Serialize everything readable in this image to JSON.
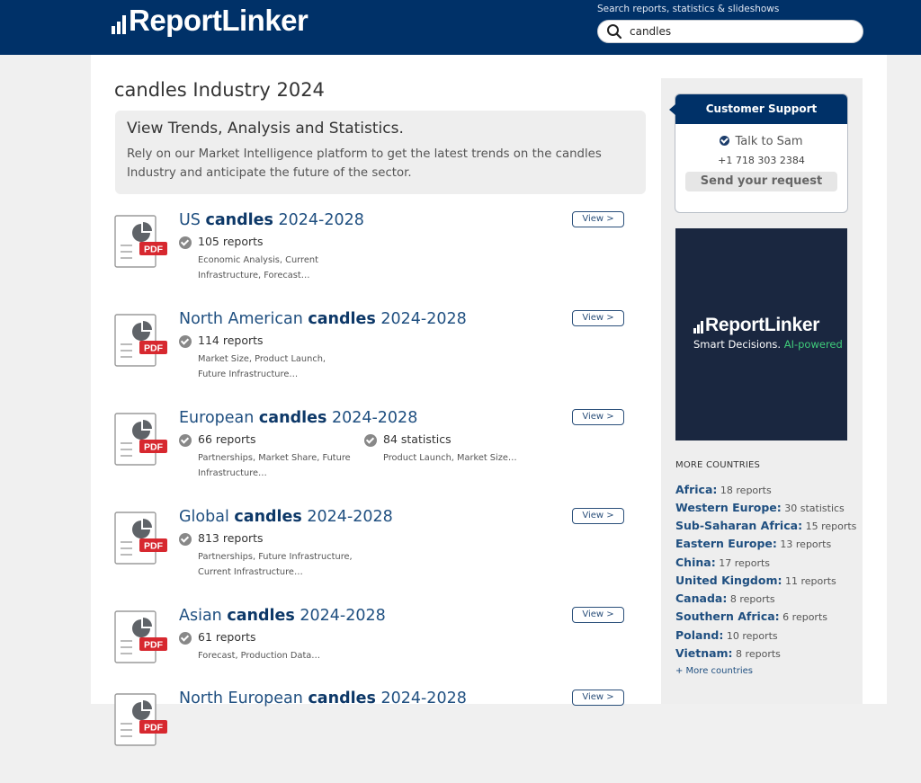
{
  "header": {
    "logo_text": "ReportLinker",
    "search_hint": "Search reports, statistics & slideshows",
    "search_value": "candles"
  },
  "page": {
    "title": "candles Industry 2024",
    "intro_title": "View Trends, Analysis and Statistics.",
    "intro_text": "Rely on our Market Intelligence platform to get the latest trends on the candles Industry and anticipate the future of the sector."
  },
  "results": [
    {
      "prefix": "US ",
      "keyword": "candles",
      "suffix": " 2024-2028",
      "view_label": "View >",
      "reports_count": "105 reports",
      "reports_desc": "Economic Analysis, Current Infrastructure, Forecast…"
    },
    {
      "prefix": "North American ",
      "keyword": "candles",
      "suffix": " 2024-2028",
      "view_label": "View >",
      "reports_count": "114 reports",
      "reports_desc": "Market Size, Product Launch, Future Infrastructure…"
    },
    {
      "prefix": "European ",
      "keyword": "candles",
      "suffix": " 2024-2028",
      "view_label": "View >",
      "reports_count": "66 reports",
      "reports_desc": "Partnerships, Market Share, Future Infrastructure…",
      "stats_count": "84 statistics",
      "stats_desc": "Product Launch, Market Size…"
    },
    {
      "prefix": "Global ",
      "keyword": "candles",
      "suffix": " 2024-2028",
      "view_label": "View >",
      "reports_count": "813 reports",
      "reports_desc": "Partnerships, Future Infrastructure, Current Infrastructure…"
    },
    {
      "prefix": "Asian ",
      "keyword": "candles",
      "suffix": " 2024-2028",
      "view_label": "View >",
      "reports_count": "61 reports",
      "reports_desc": "Forecast, Production Data…"
    },
    {
      "prefix": "North European ",
      "keyword": "candles",
      "suffix": " 2024-2028",
      "view_label": "View >"
    }
  ],
  "icons": {
    "pdf_label": "PDF"
  },
  "support": {
    "title": "Customer Support",
    "contact": "Talk to Sam",
    "phone": "+1 718 303 2384",
    "button": "Send your request"
  },
  "ad": {
    "logo_text": "ReportLinker",
    "tagline_main": "Smart Decisions. ",
    "tagline_ai": "AI-powered"
  },
  "more_countries": {
    "heading": "MORE COUNTRIES",
    "items": [
      {
        "name": "Africa:",
        "count": " 18 reports"
      },
      {
        "name": "Western Europe:",
        "count": " 30 statistics"
      },
      {
        "name": "Sub-Saharan Africa:",
        "count": " 15 reports"
      },
      {
        "name": "Eastern Europe:",
        "count": " 13 reports"
      },
      {
        "name": "China:",
        "count": " 17 reports"
      },
      {
        "name": "United Kingdom:",
        "count": " 11 reports"
      },
      {
        "name": "Canada:",
        "count": " 8 reports"
      },
      {
        "name": "Southern Africa:",
        "count": " 6 reports"
      },
      {
        "name": "Poland:",
        "count": " 10 reports"
      },
      {
        "name": "Vietnam:",
        "count": " 8 reports"
      }
    ],
    "more_link": "+ More countries"
  },
  "colors": {
    "header_bg": "#003168",
    "link": "#1f4f80",
    "pdf_badge": "#d7282f",
    "ad_bg": "#1a2740",
    "ai_accent": "#3fcc7a"
  }
}
